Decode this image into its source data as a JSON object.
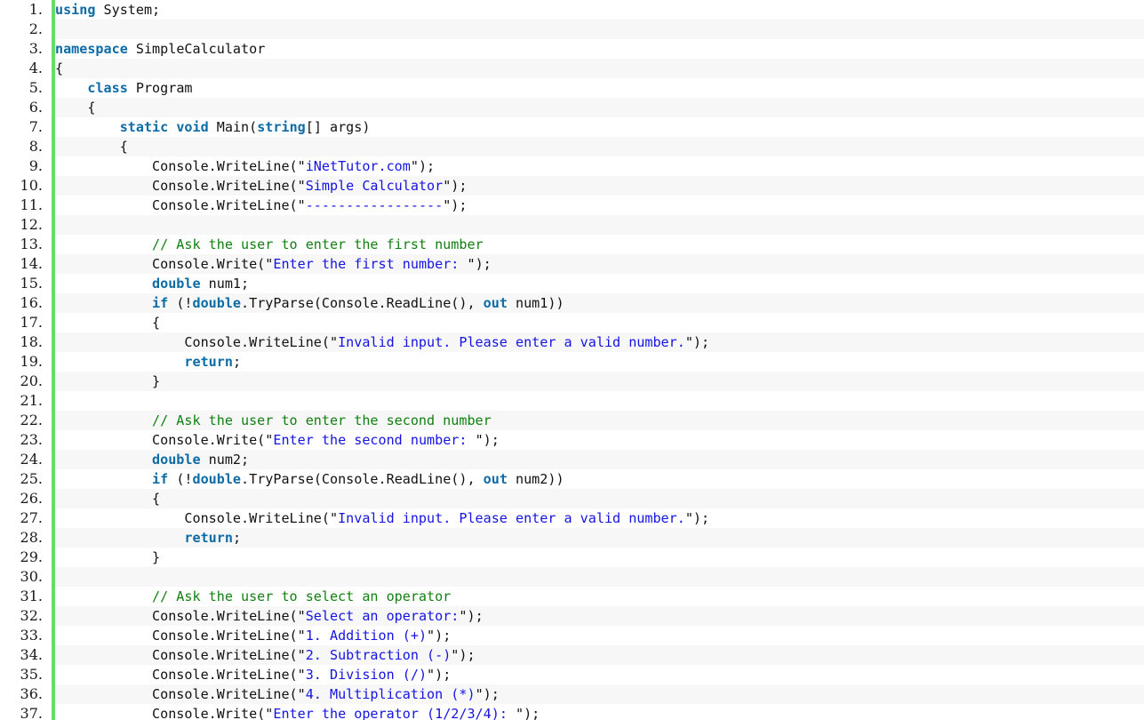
{
  "editor": {
    "language": "csharp",
    "marker_color": "#67dd67",
    "colors": {
      "keyword": "#0d6ba5",
      "string": "#1414e0",
      "comment": "#108010",
      "plain": "#111111",
      "row_odd_bg": "#ffffff",
      "row_even_bg": "#f7f7f7",
      "gutter_bg": "#ffffff",
      "line_number": "#1a1a1a"
    },
    "first_line": 1,
    "last_line": 37,
    "total_visible_lines": 37
  },
  "lines": [
    {
      "n": "1.",
      "tokens": [
        {
          "t": "kw",
          "v": "using"
        },
        {
          "t": "pln",
          "v": " System;"
        }
      ]
    },
    {
      "n": "2.",
      "tokens": []
    },
    {
      "n": "3.",
      "tokens": [
        {
          "t": "kw",
          "v": "namespace"
        },
        {
          "t": "pln",
          "v": " SimpleCalculator"
        }
      ]
    },
    {
      "n": "4.",
      "tokens": [
        {
          "t": "pun",
          "v": "{"
        }
      ]
    },
    {
      "n": "5.",
      "tokens": [
        {
          "t": "pln",
          "v": "    "
        },
        {
          "t": "kw",
          "v": "class"
        },
        {
          "t": "pln",
          "v": " Program"
        }
      ]
    },
    {
      "n": "6.",
      "tokens": [
        {
          "t": "pun",
          "v": "    {"
        }
      ]
    },
    {
      "n": "7.",
      "tokens": [
        {
          "t": "pln",
          "v": "        "
        },
        {
          "t": "kw",
          "v": "static"
        },
        {
          "t": "pln",
          "v": " "
        },
        {
          "t": "kw",
          "v": "void"
        },
        {
          "t": "pln",
          "v": " Main("
        },
        {
          "t": "kw",
          "v": "string"
        },
        {
          "t": "pln",
          "v": "[] args)"
        }
      ]
    },
    {
      "n": "8.",
      "tokens": [
        {
          "t": "pun",
          "v": "        {"
        }
      ]
    },
    {
      "n": "9.",
      "tokens": [
        {
          "t": "pln",
          "v": "            Console.WriteLine("
        },
        {
          "t": "pun",
          "v": "\""
        },
        {
          "t": "str",
          "v": "iNetTutor.com"
        },
        {
          "t": "pun",
          "v": "\""
        },
        {
          "t": "pln",
          "v": ");"
        }
      ]
    },
    {
      "n": "10.",
      "tokens": [
        {
          "t": "pln",
          "v": "            Console.WriteLine("
        },
        {
          "t": "pun",
          "v": "\""
        },
        {
          "t": "str",
          "v": "Simple Calculator"
        },
        {
          "t": "pun",
          "v": "\""
        },
        {
          "t": "pln",
          "v": ");"
        }
      ]
    },
    {
      "n": "11.",
      "tokens": [
        {
          "t": "pln",
          "v": "            Console.WriteLine("
        },
        {
          "t": "pun",
          "v": "\""
        },
        {
          "t": "str",
          "v": "-----------------"
        },
        {
          "t": "pun",
          "v": "\""
        },
        {
          "t": "pln",
          "v": ");"
        }
      ]
    },
    {
      "n": "12.",
      "tokens": []
    },
    {
      "n": "13.",
      "tokens": [
        {
          "t": "pln",
          "v": "            "
        },
        {
          "t": "cmt",
          "v": "// Ask the user to enter the first number"
        }
      ]
    },
    {
      "n": "14.",
      "tokens": [
        {
          "t": "pln",
          "v": "            Console.Write("
        },
        {
          "t": "pun",
          "v": "\""
        },
        {
          "t": "str",
          "v": "Enter the first number: "
        },
        {
          "t": "pun",
          "v": "\""
        },
        {
          "t": "pln",
          "v": ");"
        }
      ]
    },
    {
      "n": "15.",
      "tokens": [
        {
          "t": "pln",
          "v": "            "
        },
        {
          "t": "kw",
          "v": "double"
        },
        {
          "t": "pln",
          "v": " num1;"
        }
      ]
    },
    {
      "n": "16.",
      "tokens": [
        {
          "t": "pln",
          "v": "            "
        },
        {
          "t": "kw",
          "v": "if"
        },
        {
          "t": "pln",
          "v": " (!"
        },
        {
          "t": "kw",
          "v": "double"
        },
        {
          "t": "pln",
          "v": ".TryParse(Console.ReadLine(), "
        },
        {
          "t": "kw",
          "v": "out"
        },
        {
          "t": "pln",
          "v": " num1))"
        }
      ]
    },
    {
      "n": "17.",
      "tokens": [
        {
          "t": "pun",
          "v": "            {"
        }
      ]
    },
    {
      "n": "18.",
      "tokens": [
        {
          "t": "pln",
          "v": "                Console.WriteLine("
        },
        {
          "t": "pun",
          "v": "\""
        },
        {
          "t": "str",
          "v": "Invalid input. Please enter a valid number."
        },
        {
          "t": "pun",
          "v": "\""
        },
        {
          "t": "pln",
          "v": ");"
        }
      ]
    },
    {
      "n": "19.",
      "tokens": [
        {
          "t": "pln",
          "v": "                "
        },
        {
          "t": "kw",
          "v": "return"
        },
        {
          "t": "pln",
          "v": ";"
        }
      ]
    },
    {
      "n": "20.",
      "tokens": [
        {
          "t": "pun",
          "v": "            }"
        }
      ]
    },
    {
      "n": "21.",
      "tokens": []
    },
    {
      "n": "22.",
      "tokens": [
        {
          "t": "pln",
          "v": "            "
        },
        {
          "t": "cmt",
          "v": "// Ask the user to enter the second number"
        }
      ]
    },
    {
      "n": "23.",
      "tokens": [
        {
          "t": "pln",
          "v": "            Console.Write("
        },
        {
          "t": "pun",
          "v": "\""
        },
        {
          "t": "str",
          "v": "Enter the second number: "
        },
        {
          "t": "pun",
          "v": "\""
        },
        {
          "t": "pln",
          "v": ");"
        }
      ]
    },
    {
      "n": "24.",
      "tokens": [
        {
          "t": "pln",
          "v": "            "
        },
        {
          "t": "kw",
          "v": "double"
        },
        {
          "t": "pln",
          "v": " num2;"
        }
      ]
    },
    {
      "n": "25.",
      "tokens": [
        {
          "t": "pln",
          "v": "            "
        },
        {
          "t": "kw",
          "v": "if"
        },
        {
          "t": "pln",
          "v": " (!"
        },
        {
          "t": "kw",
          "v": "double"
        },
        {
          "t": "pln",
          "v": ".TryParse(Console.ReadLine(), "
        },
        {
          "t": "kw",
          "v": "out"
        },
        {
          "t": "pln",
          "v": " num2))"
        }
      ]
    },
    {
      "n": "26.",
      "tokens": [
        {
          "t": "pun",
          "v": "            {"
        }
      ]
    },
    {
      "n": "27.",
      "tokens": [
        {
          "t": "pln",
          "v": "                Console.WriteLine("
        },
        {
          "t": "pun",
          "v": "\""
        },
        {
          "t": "str",
          "v": "Invalid input. Please enter a valid number."
        },
        {
          "t": "pun",
          "v": "\""
        },
        {
          "t": "pln",
          "v": ");"
        }
      ]
    },
    {
      "n": "28.",
      "tokens": [
        {
          "t": "pln",
          "v": "                "
        },
        {
          "t": "kw",
          "v": "return"
        },
        {
          "t": "pln",
          "v": ";"
        }
      ]
    },
    {
      "n": "29.",
      "tokens": [
        {
          "t": "pun",
          "v": "            }"
        }
      ]
    },
    {
      "n": "30.",
      "tokens": []
    },
    {
      "n": "31.",
      "tokens": [
        {
          "t": "pln",
          "v": "            "
        },
        {
          "t": "cmt",
          "v": "// Ask the user to select an operator"
        }
      ]
    },
    {
      "n": "32.",
      "tokens": [
        {
          "t": "pln",
          "v": "            Console.WriteLine("
        },
        {
          "t": "pun",
          "v": "\""
        },
        {
          "t": "str",
          "v": "Select an operator:"
        },
        {
          "t": "pun",
          "v": "\""
        },
        {
          "t": "pln",
          "v": ");"
        }
      ]
    },
    {
      "n": "33.",
      "tokens": [
        {
          "t": "pln",
          "v": "            Console.WriteLine("
        },
        {
          "t": "pun",
          "v": "\""
        },
        {
          "t": "str",
          "v": "1. Addition (+)"
        },
        {
          "t": "pun",
          "v": "\""
        },
        {
          "t": "pln",
          "v": ");"
        }
      ]
    },
    {
      "n": "34.",
      "tokens": [
        {
          "t": "pln",
          "v": "            Console.WriteLine("
        },
        {
          "t": "pun",
          "v": "\""
        },
        {
          "t": "str",
          "v": "2. Subtraction (-)"
        },
        {
          "t": "pun",
          "v": "\""
        },
        {
          "t": "pln",
          "v": ");"
        }
      ]
    },
    {
      "n": "35.",
      "tokens": [
        {
          "t": "pln",
          "v": "            Console.WriteLine("
        },
        {
          "t": "pun",
          "v": "\""
        },
        {
          "t": "str",
          "v": "3. Division (/)"
        },
        {
          "t": "pun",
          "v": "\""
        },
        {
          "t": "pln",
          "v": ");"
        }
      ]
    },
    {
      "n": "36.",
      "tokens": [
        {
          "t": "pln",
          "v": "            Console.WriteLine("
        },
        {
          "t": "pun",
          "v": "\""
        },
        {
          "t": "str",
          "v": "4. Multiplication (*)"
        },
        {
          "t": "pun",
          "v": "\""
        },
        {
          "t": "pln",
          "v": ");"
        }
      ]
    },
    {
      "n": "37.",
      "tokens": [
        {
          "t": "pln",
          "v": "            Console.Write("
        },
        {
          "t": "pun",
          "v": "\""
        },
        {
          "t": "str",
          "v": "Enter the operator (1/2/3/4): "
        },
        {
          "t": "pun",
          "v": "\""
        },
        {
          "t": "pln",
          "v": ");"
        }
      ]
    }
  ]
}
